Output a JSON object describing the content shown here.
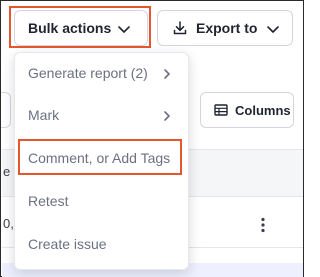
{
  "toolbar": {
    "bulk_actions_label": "Bulk actions",
    "export_label": "Export to",
    "columns_label": "Columns"
  },
  "menu": {
    "items": [
      {
        "label": "Generate report (2)",
        "has_submenu": true
      },
      {
        "label": "Mark",
        "has_submenu": true
      },
      {
        "label": "Comment, or Add Tags",
        "has_submenu": false,
        "highlighted": true
      },
      {
        "label": "Retest",
        "has_submenu": false
      },
      {
        "label": "Create issue",
        "has_submenu": false
      }
    ]
  },
  "background": {
    "header_fragment": "e",
    "row_fragment": "0,"
  },
  "colors": {
    "highlight": "#e4572e",
    "text_primary": "#1f2430",
    "text_menu": "#6b7180",
    "border": "#d3d6dd"
  },
  "icons": {
    "chevron": "chevron-down-icon",
    "download": "download-icon",
    "columns": "columns-table-icon",
    "submenu": "chevron-right-icon",
    "more": "more-vertical-icon"
  }
}
